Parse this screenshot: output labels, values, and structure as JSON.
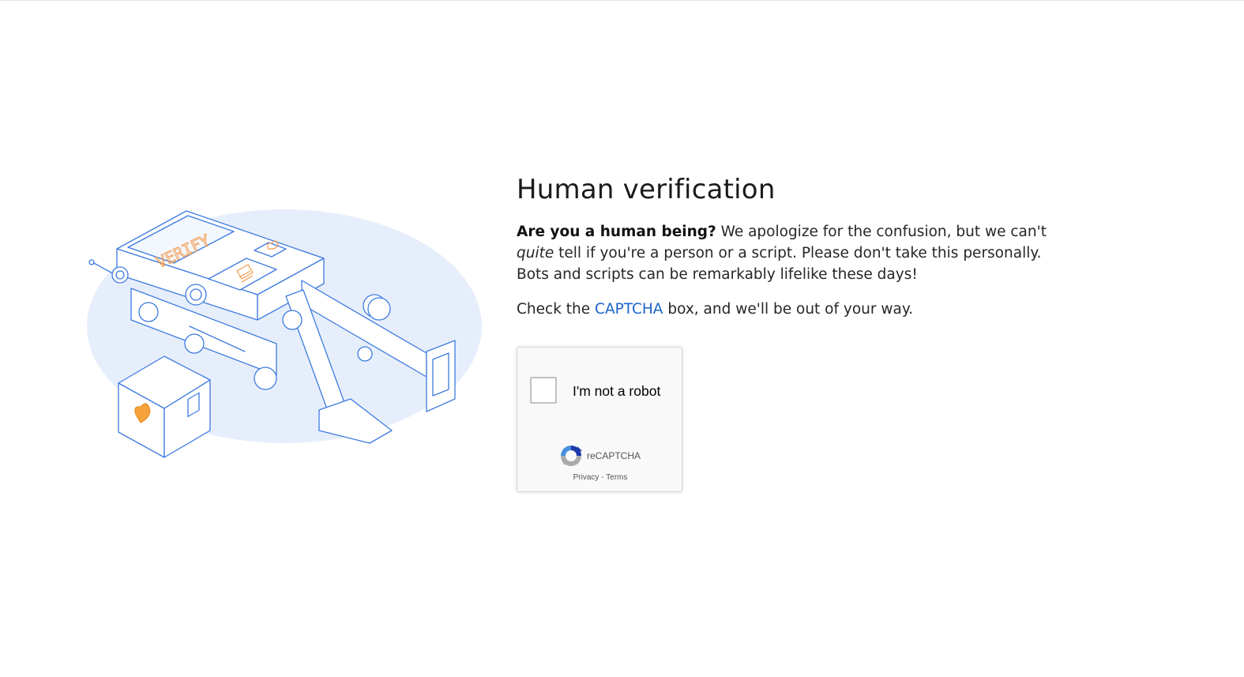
{
  "page": {
    "title": "Human verification",
    "lead_bold": "Are you a human being?",
    "lead_text_1": " We apologize for the confusion, but we can't ",
    "lead_italic": "quite",
    "lead_text_2": " tell if you're a person or a script. Please don't take this personally. Bots and scripts can be remarkably lifelike these days!",
    "check_prefix": "Check the ",
    "check_link": "CAPTCHA",
    "check_suffix": " box, and we'll be out of your way."
  },
  "illustration": {
    "screen_text": "VERIFY"
  },
  "recaptcha": {
    "label": "I'm not a robot",
    "brand": "reCAPTCHA",
    "privacy": "Privacy",
    "separator": " - ",
    "terms": "Terms",
    "checked": false
  },
  "colors": {
    "accent": "#1a63c9",
    "blob": "#e8effb",
    "line": "#3d7be0",
    "orange": "#f39a4a"
  }
}
